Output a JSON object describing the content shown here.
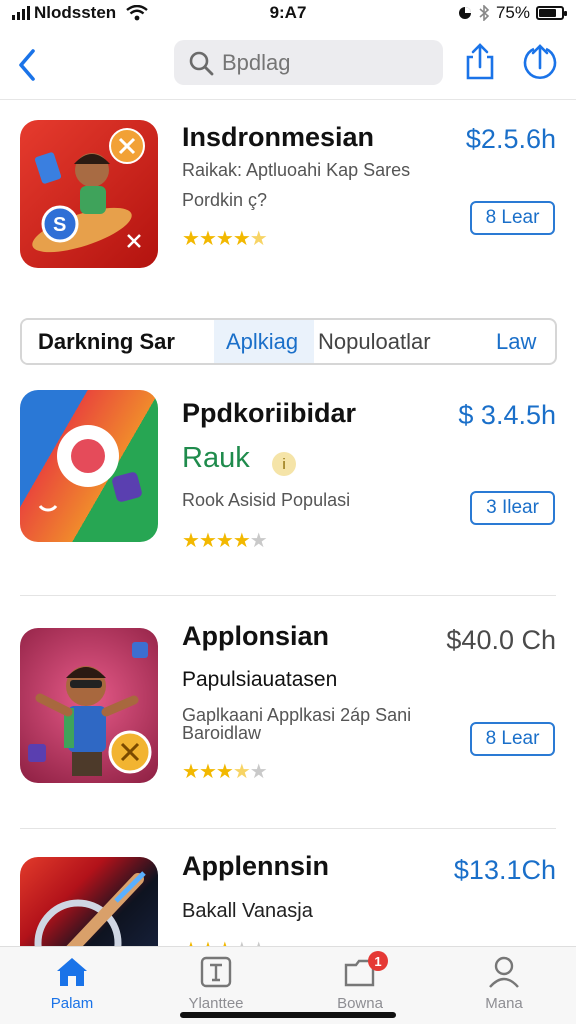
{
  "status_bar": {
    "carrier": "Nlodssten",
    "time": "9:A7",
    "battery": "75%",
    "battery_level": 0.75
  },
  "nav": {
    "search_placeholder": "Bpdlag"
  },
  "segment": {
    "tabs": [
      {
        "label": "Darkning Sar",
        "selected": true
      },
      {
        "label": "Aplkiag",
        "selected": false
      },
      {
        "label": "Nopuloatlar",
        "selected": false
      },
      {
        "label": "Law",
        "selected": false
      }
    ]
  },
  "apps": [
    {
      "name": "Insdronmesian",
      "price": "$2.5.6h",
      "line1": "Raikak: Aptluoahi Kap Sares",
      "line2": "Pordkin ç?",
      "rating": 4.5,
      "button": "8 Lear"
    },
    {
      "name": "Ppdkoriibidar",
      "price": "$ 3.4.5h",
      "subtitle": "Rauk",
      "line2": "Rook Asisid Populasi",
      "rating": 4,
      "button": "3 Ilear"
    },
    {
      "name": "Applonsian",
      "price": "$40.0 Ch",
      "line1": "Papulsiauatasen",
      "line2": "Gaplkaani Applkasi 2áp Sani",
      "line3": "Baroidlaw",
      "rating": 3.5,
      "button": "8 Lear"
    },
    {
      "name": "Applennsin",
      "price": "$13.1Ch",
      "line1": "Bakall Vanasja",
      "rating": 3
    }
  ],
  "tab_bar": {
    "items": [
      {
        "label": "Palam",
        "icon": "home-icon",
        "active": true
      },
      {
        "label": "Ylanttee",
        "icon": "apps-icon",
        "active": false
      },
      {
        "label": "Bowna",
        "icon": "updates-icon",
        "active": false,
        "badge": "1"
      },
      {
        "label": "Mana",
        "icon": "account-icon",
        "active": false
      }
    ]
  },
  "colors": {
    "accent": "#1a73e8",
    "star": "#f2b800",
    "badge": "#e53935"
  }
}
